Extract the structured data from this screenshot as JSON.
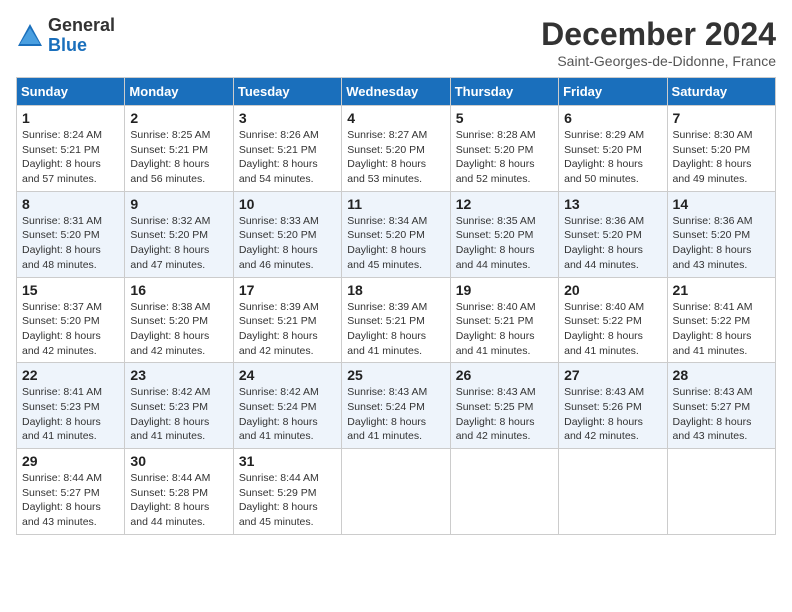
{
  "header": {
    "logo_general": "General",
    "logo_blue": "Blue",
    "month": "December 2024",
    "location": "Saint-Georges-de-Didonne, France"
  },
  "weekdays": [
    "Sunday",
    "Monday",
    "Tuesday",
    "Wednesday",
    "Thursday",
    "Friday",
    "Saturday"
  ],
  "weeks": [
    [
      {
        "day": "1",
        "sunrise": "Sunrise: 8:24 AM",
        "sunset": "Sunset: 5:21 PM",
        "daylight": "Daylight: 8 hours and 57 minutes."
      },
      {
        "day": "2",
        "sunrise": "Sunrise: 8:25 AM",
        "sunset": "Sunset: 5:21 PM",
        "daylight": "Daylight: 8 hours and 56 minutes."
      },
      {
        "day": "3",
        "sunrise": "Sunrise: 8:26 AM",
        "sunset": "Sunset: 5:21 PM",
        "daylight": "Daylight: 8 hours and 54 minutes."
      },
      {
        "day": "4",
        "sunrise": "Sunrise: 8:27 AM",
        "sunset": "Sunset: 5:20 PM",
        "daylight": "Daylight: 8 hours and 53 minutes."
      },
      {
        "day": "5",
        "sunrise": "Sunrise: 8:28 AM",
        "sunset": "Sunset: 5:20 PM",
        "daylight": "Daylight: 8 hours and 52 minutes."
      },
      {
        "day": "6",
        "sunrise": "Sunrise: 8:29 AM",
        "sunset": "Sunset: 5:20 PM",
        "daylight": "Daylight: 8 hours and 50 minutes."
      },
      {
        "day": "7",
        "sunrise": "Sunrise: 8:30 AM",
        "sunset": "Sunset: 5:20 PM",
        "daylight": "Daylight: 8 hours and 49 minutes."
      }
    ],
    [
      {
        "day": "8",
        "sunrise": "Sunrise: 8:31 AM",
        "sunset": "Sunset: 5:20 PM",
        "daylight": "Daylight: 8 hours and 48 minutes."
      },
      {
        "day": "9",
        "sunrise": "Sunrise: 8:32 AM",
        "sunset": "Sunset: 5:20 PM",
        "daylight": "Daylight: 8 hours and 47 minutes."
      },
      {
        "day": "10",
        "sunrise": "Sunrise: 8:33 AM",
        "sunset": "Sunset: 5:20 PM",
        "daylight": "Daylight: 8 hours and 46 minutes."
      },
      {
        "day": "11",
        "sunrise": "Sunrise: 8:34 AM",
        "sunset": "Sunset: 5:20 PM",
        "daylight": "Daylight: 8 hours and 45 minutes."
      },
      {
        "day": "12",
        "sunrise": "Sunrise: 8:35 AM",
        "sunset": "Sunset: 5:20 PM",
        "daylight": "Daylight: 8 hours and 44 minutes."
      },
      {
        "day": "13",
        "sunrise": "Sunrise: 8:36 AM",
        "sunset": "Sunset: 5:20 PM",
        "daylight": "Daylight: 8 hours and 44 minutes."
      },
      {
        "day": "14",
        "sunrise": "Sunrise: 8:36 AM",
        "sunset": "Sunset: 5:20 PM",
        "daylight": "Daylight: 8 hours and 43 minutes."
      }
    ],
    [
      {
        "day": "15",
        "sunrise": "Sunrise: 8:37 AM",
        "sunset": "Sunset: 5:20 PM",
        "daylight": "Daylight: 8 hours and 42 minutes."
      },
      {
        "day": "16",
        "sunrise": "Sunrise: 8:38 AM",
        "sunset": "Sunset: 5:20 PM",
        "daylight": "Daylight: 8 hours and 42 minutes."
      },
      {
        "day": "17",
        "sunrise": "Sunrise: 8:39 AM",
        "sunset": "Sunset: 5:21 PM",
        "daylight": "Daylight: 8 hours and 42 minutes."
      },
      {
        "day": "18",
        "sunrise": "Sunrise: 8:39 AM",
        "sunset": "Sunset: 5:21 PM",
        "daylight": "Daylight: 8 hours and 41 minutes."
      },
      {
        "day": "19",
        "sunrise": "Sunrise: 8:40 AM",
        "sunset": "Sunset: 5:21 PM",
        "daylight": "Daylight: 8 hours and 41 minutes."
      },
      {
        "day": "20",
        "sunrise": "Sunrise: 8:40 AM",
        "sunset": "Sunset: 5:22 PM",
        "daylight": "Daylight: 8 hours and 41 minutes."
      },
      {
        "day": "21",
        "sunrise": "Sunrise: 8:41 AM",
        "sunset": "Sunset: 5:22 PM",
        "daylight": "Daylight: 8 hours and 41 minutes."
      }
    ],
    [
      {
        "day": "22",
        "sunrise": "Sunrise: 8:41 AM",
        "sunset": "Sunset: 5:23 PM",
        "daylight": "Daylight: 8 hours and 41 minutes."
      },
      {
        "day": "23",
        "sunrise": "Sunrise: 8:42 AM",
        "sunset": "Sunset: 5:23 PM",
        "daylight": "Daylight: 8 hours and 41 minutes."
      },
      {
        "day": "24",
        "sunrise": "Sunrise: 8:42 AM",
        "sunset": "Sunset: 5:24 PM",
        "daylight": "Daylight: 8 hours and 41 minutes."
      },
      {
        "day": "25",
        "sunrise": "Sunrise: 8:43 AM",
        "sunset": "Sunset: 5:24 PM",
        "daylight": "Daylight: 8 hours and 41 minutes."
      },
      {
        "day": "26",
        "sunrise": "Sunrise: 8:43 AM",
        "sunset": "Sunset: 5:25 PM",
        "daylight": "Daylight: 8 hours and 42 minutes."
      },
      {
        "day": "27",
        "sunrise": "Sunrise: 8:43 AM",
        "sunset": "Sunset: 5:26 PM",
        "daylight": "Daylight: 8 hours and 42 minutes."
      },
      {
        "day": "28",
        "sunrise": "Sunrise: 8:43 AM",
        "sunset": "Sunset: 5:27 PM",
        "daylight": "Daylight: 8 hours and 43 minutes."
      }
    ],
    [
      {
        "day": "29",
        "sunrise": "Sunrise: 8:44 AM",
        "sunset": "Sunset: 5:27 PM",
        "daylight": "Daylight: 8 hours and 43 minutes."
      },
      {
        "day": "30",
        "sunrise": "Sunrise: 8:44 AM",
        "sunset": "Sunset: 5:28 PM",
        "daylight": "Daylight: 8 hours and 44 minutes."
      },
      {
        "day": "31",
        "sunrise": "Sunrise: 8:44 AM",
        "sunset": "Sunset: 5:29 PM",
        "daylight": "Daylight: 8 hours and 45 minutes."
      },
      null,
      null,
      null,
      null
    ]
  ]
}
